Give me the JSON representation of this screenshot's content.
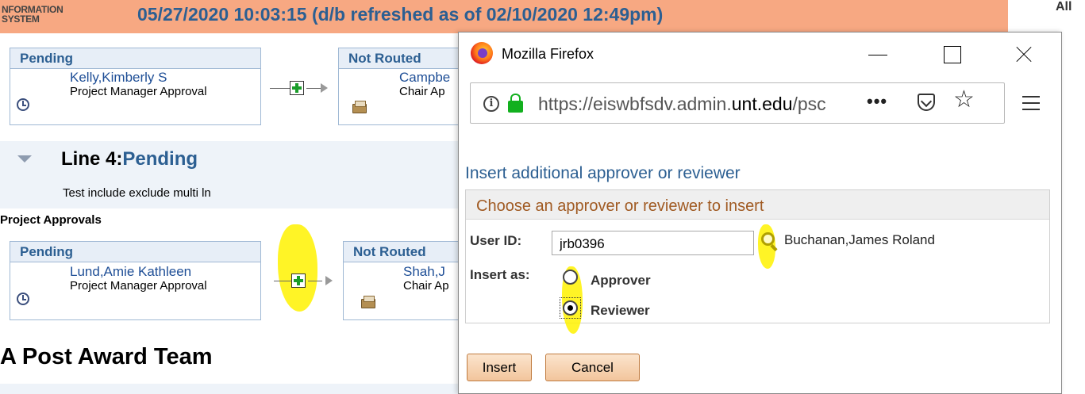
{
  "header": {
    "system_line1": "NFORMATION",
    "system_line2": "SYSTEM",
    "datetime_title": "05/27/2020 10:03:15 (d/b refreshed as of 02/10/2020 12:49pm)",
    "right_label": "All"
  },
  "line3": {
    "step1": {
      "status": "Pending",
      "name": "Kelly,Kimberly S",
      "role": "Project Manager Approval"
    },
    "step2": {
      "status": "Not Routed",
      "name": "Campbe",
      "role": "Chair Ap"
    }
  },
  "line4": {
    "label": "Line 4:",
    "status": "Pending",
    "description": "Test include exclude multi ln",
    "section_label": "Project Approvals",
    "step1": {
      "status": "Pending",
      "name": "Lund,Amie Kathleen",
      "role": "Project Manager Approval"
    },
    "step2": {
      "status": "Not Routed",
      "name": "Shah,J",
      "role": "Chair Ap"
    }
  },
  "team_heading": "A Post Award Team",
  "popup": {
    "window_title": "Mozilla Firefox",
    "url_prefix": "https://eiswbfsdv.admin.",
    "url_domain": "unt.edu",
    "url_suffix": "/psc",
    "url_more": "•••",
    "dialog_title": "Insert additional approver or reviewer",
    "panel_title": "Choose an approver or reviewer to insert",
    "user_id_label": "User ID:",
    "user_id_value": "jrb0396",
    "user_name": "Buchanan,James Roland",
    "insert_as_label": "Insert as:",
    "options": [
      "Approver",
      "Reviewer"
    ],
    "selected_option": "Reviewer",
    "insert_button": "Insert",
    "cancel_button": "Cancel"
  },
  "colors": {
    "header_bg": "#f7a882",
    "header_title": "#2c5f92",
    "link_blue": "#1e4e96",
    "panel_title": "#a05a22",
    "highlight": "#fff200",
    "add_icon_green": "#1a9d2a"
  }
}
